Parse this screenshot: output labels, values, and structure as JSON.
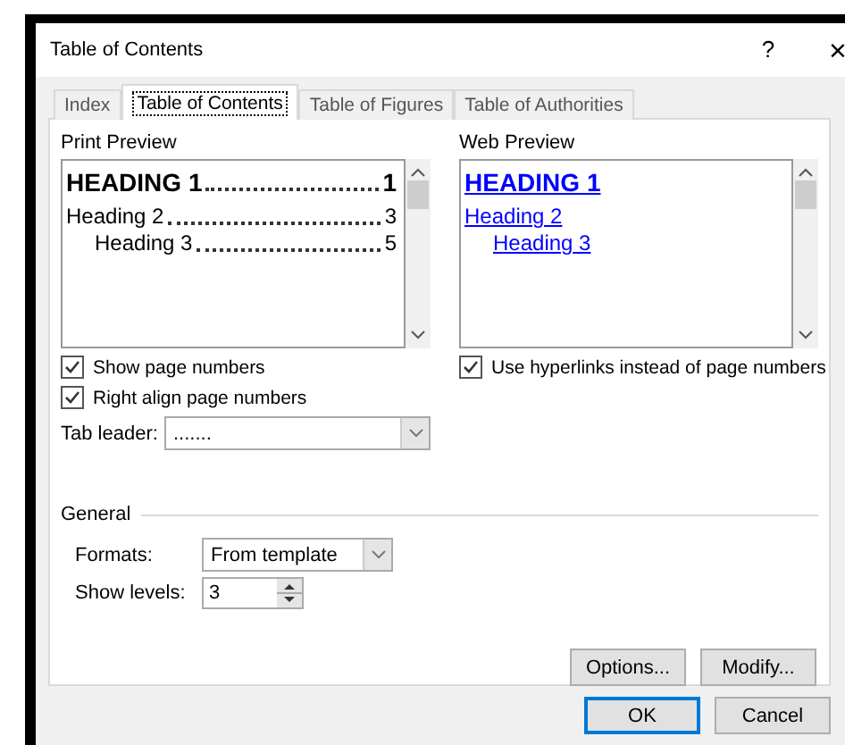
{
  "dialog": {
    "title": "Table of Contents",
    "help": "?",
    "close": "×"
  },
  "tabs": [
    {
      "label": "Index",
      "selected": false
    },
    {
      "label": "Table of Contents",
      "selected": true
    },
    {
      "label": "Table of Figures",
      "selected": false
    },
    {
      "label": "Table of Authorities",
      "selected": false
    }
  ],
  "print_preview": {
    "label": "Print Preview",
    "entries": [
      {
        "kind": "h1",
        "text": "HEADING 1",
        "page": "1"
      },
      {
        "kind": "h2",
        "text": "Heading 2",
        "page": "3"
      },
      {
        "kind": "h3",
        "text": "Heading 3",
        "page": "5"
      }
    ]
  },
  "web_preview": {
    "label": "Web Preview",
    "entries": [
      {
        "kind": "h1",
        "text": "HEADING 1"
      },
      {
        "kind": "h2",
        "text": "Heading 2"
      },
      {
        "kind": "h3",
        "text": "Heading 3"
      }
    ]
  },
  "print_options": [
    {
      "label": "Show page numbers",
      "checked": true
    },
    {
      "label": "Right align page numbers",
      "checked": true
    }
  ],
  "tab_leader": {
    "label": "Tab leader:",
    "value": "......."
  },
  "web_options": [
    {
      "label": "Use hyperlinks instead of page numbers",
      "checked": true
    }
  ],
  "general": {
    "label": "General",
    "formats": {
      "label": "Formats:",
      "value": "From template"
    },
    "show_levels": {
      "label": "Show levels:",
      "value": "3"
    }
  },
  "panel_buttons": [
    {
      "label": "Options..."
    },
    {
      "label": "Modify..."
    }
  ],
  "dialog_buttons": [
    {
      "label": "OK",
      "default": true
    },
    {
      "label": "Cancel",
      "default": false
    }
  ]
}
